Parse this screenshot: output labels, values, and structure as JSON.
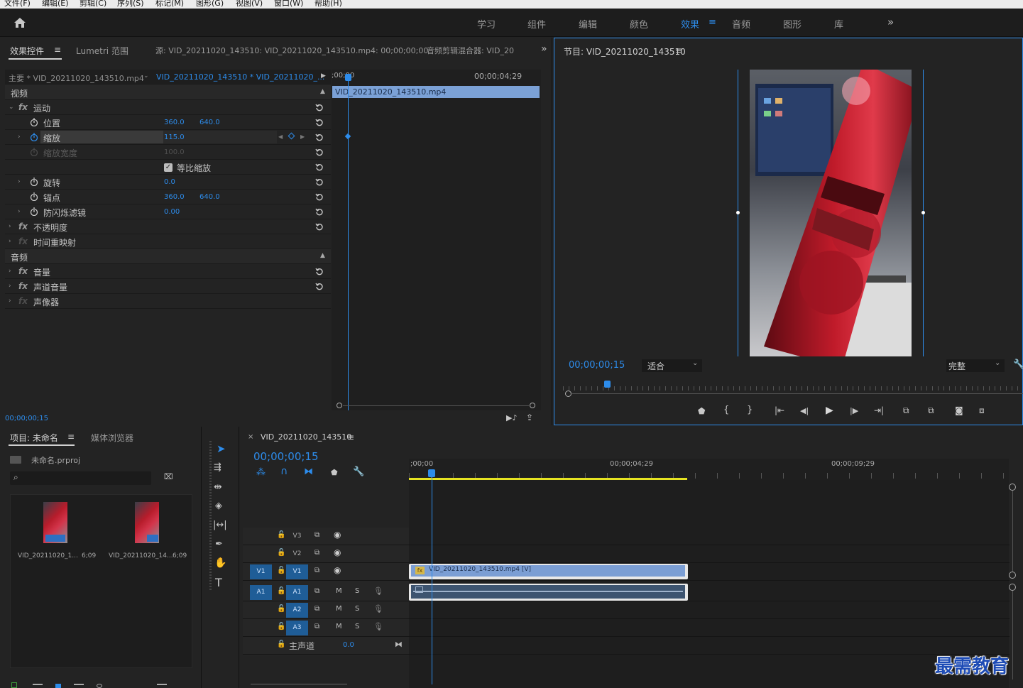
{
  "menu": [
    "文件(F)",
    "编辑(E)",
    "剪辑(C)",
    "序列(S)",
    "标记(M)",
    "图形(G)",
    "视图(V)",
    "窗口(W)",
    "帮助(H)"
  ],
  "workspaces": [
    "学习",
    "组件",
    "编辑",
    "颜色",
    "效果",
    "音频",
    "图形",
    "库"
  ],
  "active_workspace": "效果",
  "source_panel": {
    "tabs": [
      "效果控件",
      "Lumetri 范围",
      "源: VID_20211020_143510: VID_20211020_143510.mp4: 00;00;00;00",
      "音频剪辑混合器: VID_20"
    ],
    "master_clip": "主要 * VID_20211020_143510.mp4",
    "sequence_clip": "VID_20211020_143510 * VID_20211020_...",
    "timecode_start": ";00;00",
    "timecode_end": "00;00;04;29",
    "clip_bar": "VID_20211020_143510.mp4",
    "section_video": "视频",
    "section_audio": "音频",
    "motion": "运动",
    "position_label": "位置",
    "position_x": "360.0",
    "position_y": "640.0",
    "scale_label": "缩放",
    "scale_value": "115.0",
    "scale_width_label": "缩放宽度",
    "scale_width_value": "100.0",
    "uniform_scale": "等比缩放",
    "rotation_label": "旋转",
    "rotation_value": "0.0",
    "anchor_label": "锚点",
    "anchor_x": "360.0",
    "anchor_y": "640.0",
    "antiflicker_label": "防闪烁滤镜",
    "antiflicker_value": "0.00",
    "opacity": "不透明度",
    "time_remap": "时间重映射",
    "volume": "音量",
    "channel_volume": "声道音量",
    "panner": "声像器",
    "current_time": "00;00;00;15"
  },
  "program_panel": {
    "title": "节目: VID_20211020_143510",
    "timecode": "00;00;00;15",
    "fit": "适合",
    "quality": "完整"
  },
  "project_panel": {
    "tabs": [
      "项目: 未命名",
      "媒体浏览器"
    ],
    "project_file": "未命名.prproj",
    "items": [
      {
        "name": "VID_20211020_1...",
        "duration": "6;09"
      },
      {
        "name": "VID_20211020_14...",
        "duration": "6;09"
      }
    ]
  },
  "timeline": {
    "sequence": "VID_20211020_143510",
    "timecode": "00;00;00;15",
    "ruler": [
      ";00;00",
      "00;00;04;29",
      "00;00;09;29"
    ],
    "video_tracks": [
      "V3",
      "V2",
      "V1"
    ],
    "audio_tracks": [
      "A1",
      "A2",
      "A3"
    ],
    "source_v": "V1",
    "source_a": "A1",
    "mute": "M",
    "solo": "S",
    "master": "主声道",
    "master_value": "0.0",
    "video_clip": "VID_20211020_143510.mp4 [V]"
  },
  "watermark": "最需教育",
  "colors": {
    "accent": "#2d8ceb",
    "clip_video": "#7b9ed4",
    "clip_audio": "#3d5470",
    "work_area": "#e6e322"
  }
}
